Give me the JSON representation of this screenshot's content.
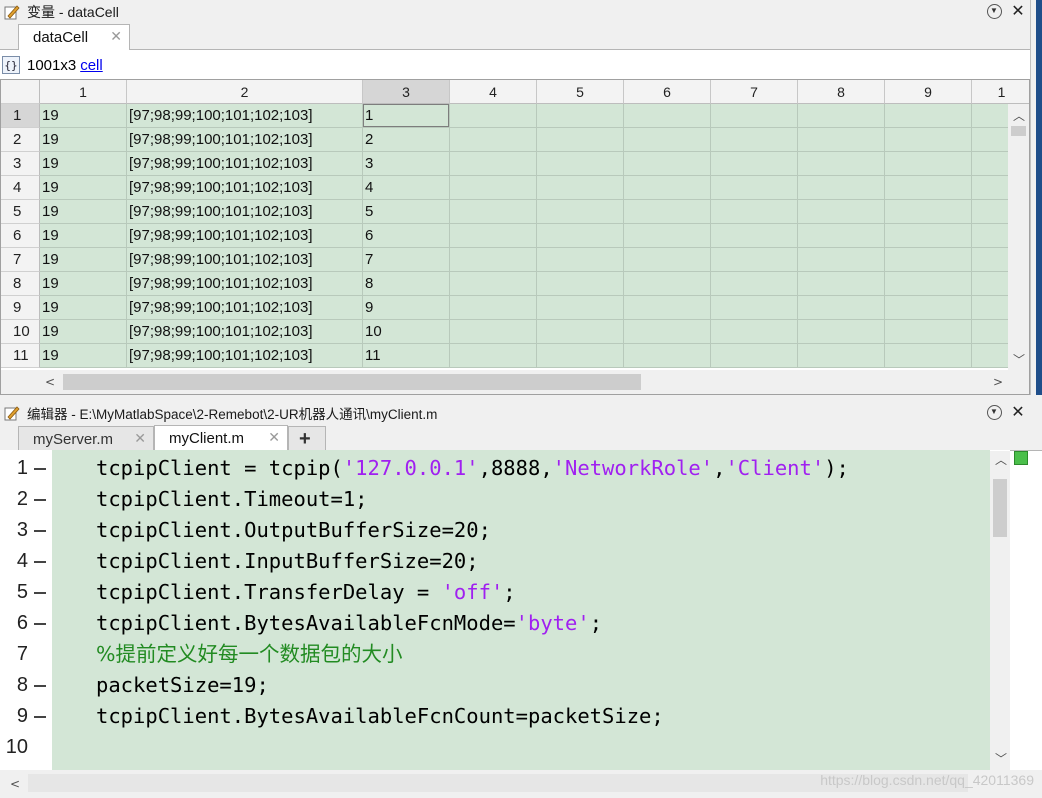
{
  "variable_panel": {
    "title": "变量 - dataCell",
    "tab_label": "dataCell",
    "size": "1001x3",
    "class_link": "cell",
    "columns": [
      "1",
      "2",
      "3",
      "4",
      "5",
      "6",
      "7",
      "8",
      "9",
      "1"
    ],
    "rows": [
      {
        "num": "1",
        "c1": "19",
        "c2": "[97;98;99;100;101;102;103]",
        "c3": "1"
      },
      {
        "num": "2",
        "c1": "19",
        "c2": "[97;98;99;100;101;102;103]",
        "c3": "2"
      },
      {
        "num": "3",
        "c1": "19",
        "c2": "[97;98;99;100;101;102;103]",
        "c3": "3"
      },
      {
        "num": "4",
        "c1": "19",
        "c2": "[97;98;99;100;101;102;103]",
        "c3": "4"
      },
      {
        "num": "5",
        "c1": "19",
        "c2": "[97;98;99;100;101;102;103]",
        "c3": "5"
      },
      {
        "num": "6",
        "c1": "19",
        "c2": "[97;98;99;100;101;102;103]",
        "c3": "6"
      },
      {
        "num": "7",
        "c1": "19",
        "c2": "[97;98;99;100;101;102;103]",
        "c3": "7"
      },
      {
        "num": "8",
        "c1": "19",
        "c2": "[97;98;99;100;101;102;103]",
        "c3": "8"
      },
      {
        "num": "9",
        "c1": "19",
        "c2": "[97;98;99;100;101;102;103]",
        "c3": "9"
      },
      {
        "num": "10",
        "c1": "19",
        "c2": "[97;98;99;100;101;102;103]",
        "c3": "10"
      },
      {
        "num": "11",
        "c1": "19",
        "c2": "[97;98;99;100;101;102;103]",
        "c3": "11"
      }
    ]
  },
  "editor": {
    "title": "编辑器 - E:\\MyMatlabSpace\\2-Remebot\\2-UR机器人通讯\\myClient.m",
    "tabs": [
      "myServer.m",
      "myClient.m"
    ],
    "add_tab_label": "+",
    "lines": [
      {
        "num": "1",
        "marker": true,
        "parts": [
          [
            "tcpipClient = tcpip(",
            "code"
          ],
          [
            "'127.0.0.1'",
            "str"
          ],
          [
            ",8888,",
            "code"
          ],
          [
            "'NetworkRole'",
            "str"
          ],
          [
            ",",
            "code"
          ],
          [
            "'Client'",
            "str"
          ],
          [
            ");",
            "code"
          ]
        ]
      },
      {
        "num": "2",
        "marker": true,
        "parts": [
          [
            "tcpipClient.Timeout=1;",
            "code"
          ]
        ]
      },
      {
        "num": "3",
        "marker": true,
        "parts": [
          [
            "tcpipClient.OutputBufferSize=20;",
            "code"
          ]
        ]
      },
      {
        "num": "4",
        "marker": true,
        "parts": [
          [
            "tcpipClient.InputBufferSize=20;",
            "code"
          ]
        ]
      },
      {
        "num": "5",
        "marker": true,
        "parts": [
          [
            "tcpipClient.TransferDelay = ",
            "code"
          ],
          [
            "'off'",
            "str"
          ],
          [
            ";",
            "code"
          ]
        ]
      },
      {
        "num": "6",
        "marker": true,
        "parts": [
          [
            "tcpipClient.BytesAvailableFcnMode=",
            "code"
          ],
          [
            "'byte'",
            "str"
          ],
          [
            ";",
            "code"
          ]
        ]
      },
      {
        "num": "7",
        "marker": false,
        "parts": [
          [
            "%提前定义好每一个数据包的大小",
            "cmt"
          ]
        ]
      },
      {
        "num": "8",
        "marker": true,
        "parts": [
          [
            "packetSize=19;",
            "code"
          ]
        ]
      },
      {
        "num": "9",
        "marker": true,
        "parts": [
          [
            "tcpipClient.BytesAvailableFcnCount=packetSize;",
            "code"
          ]
        ]
      },
      {
        "num": "10",
        "marker": false,
        "parts": [
          [
            "",
            "code"
          ]
        ]
      }
    ]
  },
  "watermark": "https://blog.csdn.net/qq_42011369",
  "colors": {
    "cell_bg": "#d3e6d6",
    "string": "#a020f0",
    "comment": "#228b22",
    "link": "#0000ee"
  }
}
